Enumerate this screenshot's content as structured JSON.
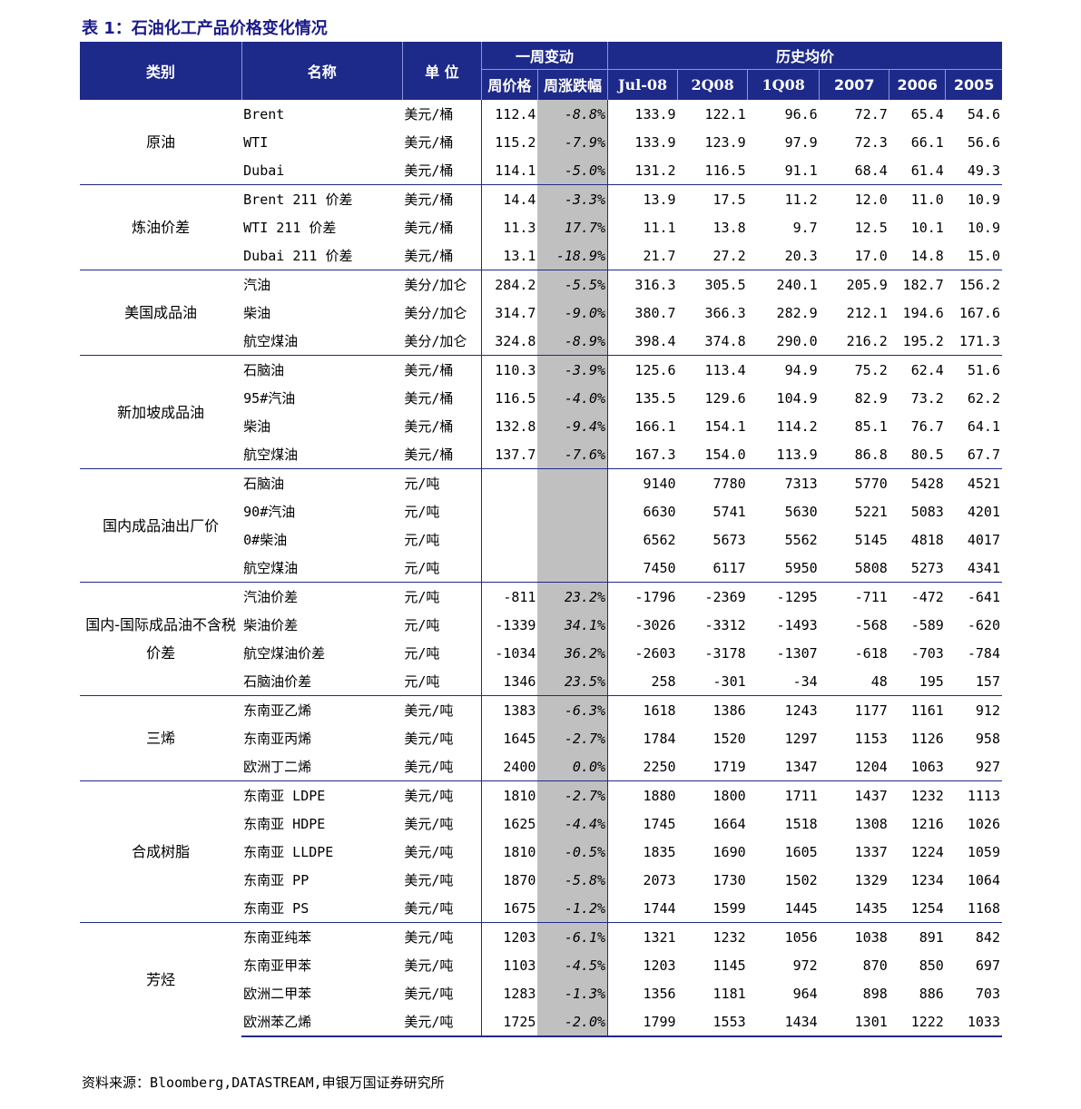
{
  "title": "表 1：石油化工产品价格变化情况",
  "headers": {
    "category": "类别",
    "name": "名称",
    "unit": "单 位",
    "weekly_group": "一周变动",
    "history_group": "历史均价",
    "week_price": "周价格",
    "week_change": "周涨跌幅",
    "periods": [
      "Jul-08",
      "2Q08",
      "1Q08",
      "2007",
      "2006",
      "2005"
    ]
  },
  "groups": [
    {
      "category": "原油",
      "rows": [
        {
          "name": "Brent",
          "unit": "美元/桶",
          "price": "112.4",
          "change": "-8.8%",
          "hist": [
            "133.9",
            "122.1",
            "96.6",
            "72.7",
            "65.4",
            "54.6"
          ]
        },
        {
          "name": "WTI",
          "unit": "美元/桶",
          "price": "115.2",
          "change": "-7.9%",
          "hist": [
            "133.9",
            "123.9",
            "97.9",
            "72.3",
            "66.1",
            "56.6"
          ]
        },
        {
          "name": "Dubai",
          "unit": "美元/桶",
          "price": "114.1",
          "change": "-5.0%",
          "hist": [
            "131.2",
            "116.5",
            "91.1",
            "68.4",
            "61.4",
            "49.3"
          ]
        }
      ]
    },
    {
      "category": "炼油价差",
      "rows": [
        {
          "name": "Brent 211 价差",
          "unit": "美元/桶",
          "price": "14.4",
          "change": "-3.3%",
          "hist": [
            "13.9",
            "17.5",
            "11.2",
            "12.0",
            "11.0",
            "10.9"
          ]
        },
        {
          "name": "WTI 211 价差",
          "unit": "美元/桶",
          "price": "11.3",
          "change": "17.7%",
          "hist": [
            "11.1",
            "13.8",
            "9.7",
            "12.5",
            "10.1",
            "10.9"
          ]
        },
        {
          "name": "Dubai 211 价差",
          "unit": "美元/桶",
          "price": "13.1",
          "change": "-18.9%",
          "hist": [
            "21.7",
            "27.2",
            "20.3",
            "17.0",
            "14.8",
            "15.0"
          ]
        }
      ]
    },
    {
      "category": "美国成品油",
      "rows": [
        {
          "name": "汽油",
          "unit": "美分/加仑",
          "price": "284.2",
          "change": "-5.5%",
          "hist": [
            "316.3",
            "305.5",
            "240.1",
            "205.9",
            "182.7",
            "156.2"
          ]
        },
        {
          "name": "柴油",
          "unit": "美分/加仑",
          "price": "314.7",
          "change": "-9.0%",
          "hist": [
            "380.7",
            "366.3",
            "282.9",
            "212.1",
            "194.6",
            "167.6"
          ]
        },
        {
          "name": "航空煤油",
          "unit": "美分/加仑",
          "price": "324.8",
          "change": "-8.9%",
          "hist": [
            "398.4",
            "374.8",
            "290.0",
            "216.2",
            "195.2",
            "171.3"
          ]
        }
      ]
    },
    {
      "category": "新加坡成品油",
      "rows": [
        {
          "name": "石脑油",
          "unit": "美元/桶",
          "price": "110.3",
          "change": "-3.9%",
          "hist": [
            "125.6",
            "113.4",
            "94.9",
            "75.2",
            "62.4",
            "51.6"
          ]
        },
        {
          "name": "95#汽油",
          "unit": "美元/桶",
          "price": "116.5",
          "change": "-4.0%",
          "hist": [
            "135.5",
            "129.6",
            "104.9",
            "82.9",
            "73.2",
            "62.2"
          ]
        },
        {
          "name": "柴油",
          "unit": "美元/桶",
          "price": "132.8",
          "change": "-9.4%",
          "hist": [
            "166.1",
            "154.1",
            "114.2",
            "85.1",
            "76.7",
            "64.1"
          ]
        },
        {
          "name": "航空煤油",
          "unit": "美元/桶",
          "price": "137.7",
          "change": "-7.6%",
          "hist": [
            "167.3",
            "154.0",
            "113.9",
            "86.8",
            "80.5",
            "67.7"
          ]
        }
      ]
    },
    {
      "category": "国内成品油出厂价",
      "rows": [
        {
          "name": "石脑油",
          "unit": "元/吨",
          "price": "",
          "change": "",
          "hist": [
            "9140",
            "7780",
            "7313",
            "5770",
            "5428",
            "4521"
          ]
        },
        {
          "name": "90#汽油",
          "unit": "元/吨",
          "price": "",
          "change": "",
          "hist": [
            "6630",
            "5741",
            "5630",
            "5221",
            "5083",
            "4201"
          ]
        },
        {
          "name": "0#柴油",
          "unit": "元/吨",
          "price": "",
          "change": "",
          "hist": [
            "6562",
            "5673",
            "5562",
            "5145",
            "4818",
            "4017"
          ]
        },
        {
          "name": "航空煤油",
          "unit": "元/吨",
          "price": "",
          "change": "",
          "hist": [
            "7450",
            "6117",
            "5950",
            "5808",
            "5273",
            "4341"
          ]
        }
      ]
    },
    {
      "category": "国内-国际成品油不含税价差",
      "rows": [
        {
          "name": "汽油价差",
          "unit": "元/吨",
          "price": "-811",
          "change": "23.2%",
          "hist": [
            "-1796",
            "-2369",
            "-1295",
            "-711",
            "-472",
            "-641"
          ]
        },
        {
          "name": "柴油价差",
          "unit": "元/吨",
          "price": "-1339",
          "change": "34.1%",
          "hist": [
            "-3026",
            "-3312",
            "-1493",
            "-568",
            "-589",
            "-620"
          ]
        },
        {
          "name": "航空煤油价差",
          "unit": "元/吨",
          "price": "-1034",
          "change": "36.2%",
          "hist": [
            "-2603",
            "-3178",
            "-1307",
            "-618",
            "-703",
            "-784"
          ]
        },
        {
          "name": "石脑油价差",
          "unit": "元/吨",
          "price": "1346",
          "change": "23.5%",
          "hist": [
            "258",
            "-301",
            "-34",
            "48",
            "195",
            "157"
          ]
        }
      ]
    },
    {
      "category": "三烯",
      "rows": [
        {
          "name": "东南亚乙烯",
          "unit": "美元/吨",
          "price": "1383",
          "change": "-6.3%",
          "hist": [
            "1618",
            "1386",
            "1243",
            "1177",
            "1161",
            "912"
          ]
        },
        {
          "name": "东南亚丙烯",
          "unit": "美元/吨",
          "price": "1645",
          "change": "-2.7%",
          "hist": [
            "1784",
            "1520",
            "1297",
            "1153",
            "1126",
            "958"
          ]
        },
        {
          "name": "欧洲丁二烯",
          "unit": "美元/吨",
          "price": "2400",
          "change": "0.0%",
          "hist": [
            "2250",
            "1719",
            "1347",
            "1204",
            "1063",
            "927"
          ]
        }
      ]
    },
    {
      "category": "合成树脂",
      "rows": [
        {
          "name": "东南亚 LDPE",
          "unit": "美元/吨",
          "price": "1810",
          "change": "-2.7%",
          "hist": [
            "1880",
            "1800",
            "1711",
            "1437",
            "1232",
            "1113"
          ]
        },
        {
          "name": "东南亚 HDPE",
          "unit": "美元/吨",
          "price": "1625",
          "change": "-4.4%",
          "hist": [
            "1745",
            "1664",
            "1518",
            "1308",
            "1216",
            "1026"
          ]
        },
        {
          "name": "东南亚 LLDPE",
          "unit": "美元/吨",
          "price": "1810",
          "change": "-0.5%",
          "hist": [
            "1835",
            "1690",
            "1605",
            "1337",
            "1224",
            "1059"
          ]
        },
        {
          "name": "东南亚 PP",
          "unit": "美元/吨",
          "price": "1870",
          "change": "-5.8%",
          "hist": [
            "2073",
            "1730",
            "1502",
            "1329",
            "1234",
            "1064"
          ]
        },
        {
          "name": "东南亚 PS",
          "unit": "美元/吨",
          "price": "1675",
          "change": "-1.2%",
          "hist": [
            "1744",
            "1599",
            "1445",
            "1435",
            "1254",
            "1168"
          ]
        }
      ]
    },
    {
      "category": "芳烃",
      "rows": [
        {
          "name": "东南亚纯苯",
          "unit": "美元/吨",
          "price": "1203",
          "change": "-6.1%",
          "hist": [
            "1321",
            "1232",
            "1056",
            "1038",
            "891",
            "842"
          ]
        },
        {
          "name": "东南亚甲苯",
          "unit": "美元/吨",
          "price": "1103",
          "change": "-4.5%",
          "hist": [
            "1203",
            "1145",
            "972",
            "870",
            "850",
            "697"
          ]
        },
        {
          "name": "欧洲二甲苯",
          "unit": "美元/吨",
          "price": "1283",
          "change": "-1.3%",
          "hist": [
            "1356",
            "1181",
            "964",
            "898",
            "886",
            "703"
          ]
        },
        {
          "name": "欧洲苯乙烯",
          "unit": "美元/吨",
          "price": "1725",
          "change": "-2.0%",
          "hist": [
            "1799",
            "1553",
            "1434",
            "1301",
            "1222",
            "1033"
          ]
        }
      ]
    }
  ],
  "source": "资料来源：Bloomberg,DATASTREAM,申银万国证券研究所"
}
